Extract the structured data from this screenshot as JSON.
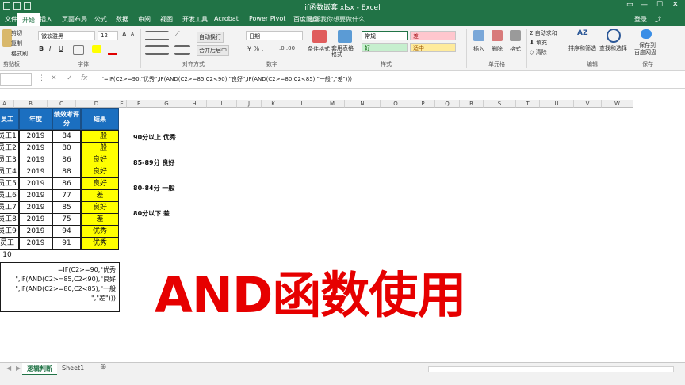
{
  "window": {
    "title": "if函数嵌套.xlsx - Excel"
  },
  "tabs": [
    "文件",
    "开始",
    "插入",
    "页面布局",
    "公式",
    "数据",
    "审阅",
    "视图",
    "开发工具",
    "Acrobat",
    "Power Pivot",
    "百度网盘"
  ],
  "active_tab": "开始",
  "tell_me": "告诉我你想要做什么...",
  "login": "登录",
  "ribbon": {
    "clipboard": {
      "cut": "剪切",
      "copy": "复制",
      "format_painter": "格式刷",
      "group": "剪贴板"
    },
    "font": {
      "name": "微软雅黑",
      "size": "12",
      "group": "字体",
      "grow": "A",
      "shrink": "A",
      "bold": "B",
      "italic": "I",
      "underline": "U"
    },
    "alignment": {
      "wrap": "自动换行",
      "merge": "合并后居中",
      "group": "对齐方式"
    },
    "number": {
      "format": "日期",
      "group": "数字"
    },
    "styles": {
      "conditional": "条件格式",
      "table": "套用表格格式",
      "normal": "常规",
      "bad": "差",
      "good": "好",
      "neutral": "适中",
      "group": "样式",
      "colors": {
        "bad_bg": "#ffc7ce",
        "bad_fg": "#9c0006",
        "good_bg": "#c6efce",
        "good_fg": "#006100",
        "neutral_bg": "#ffeb9c",
        "neutral_fg": "#9c5700"
      }
    },
    "cells": {
      "insert": "插入",
      "delete": "删除",
      "format": "格式",
      "group": "单元格"
    },
    "editing": {
      "autosum": "自动求和",
      "fill": "填充",
      "clear": "清除",
      "sort": "排序和筛选",
      "find": "查找和选择",
      "group": "编辑"
    },
    "baidu": {
      "save": "保存到",
      "save2": "百度网盘",
      "group": "保存"
    }
  },
  "formula_bar": {
    "formula": "'=IF(C2>=90,\"优秀\",IF(AND(C2>=85,C2<90),\"良好\",IF(AND(C2>=80,C2<85),\"一般\",\"差\")))",
    "cancel": "✕",
    "enter": "✓",
    "fx": "fx"
  },
  "columns": [
    "A",
    "B",
    "C",
    "D",
    "E",
    "F",
    "G",
    "H",
    "I",
    "J",
    "K",
    "L",
    "M",
    "N",
    "O",
    "P",
    "Q",
    "R",
    "S",
    "T",
    "U",
    "V",
    "W"
  ],
  "table": {
    "headers": [
      "员工",
      "年度",
      "绩效考评分",
      "结果"
    ],
    "rows": [
      [
        "员工1",
        "2019",
        "84",
        "一般"
      ],
      [
        "员工2",
        "2019",
        "80",
        "一般"
      ],
      [
        "员工3",
        "2019",
        "86",
        "良好"
      ],
      [
        "员工4",
        "2019",
        "88",
        "良好"
      ],
      [
        "员工5",
        "2019",
        "86",
        "良好"
      ],
      [
        "员工6",
        "2019",
        "77",
        "差"
      ],
      [
        "员工7",
        "2019",
        "85",
        "良好"
      ],
      [
        "员工8",
        "2019",
        "75",
        "差"
      ],
      [
        "员工9",
        "2019",
        "94",
        "优秀"
      ],
      [
        "员工10",
        "2019",
        "91",
        "优秀"
      ]
    ]
  },
  "rules": [
    "90分以上 优秀",
    "85-89分 良好",
    "80-84分 一般",
    "80分以下 差"
  ],
  "formula_cell": [
    "=IF(C2>=90,\"优秀",
    "\",IF(AND(C2>=85,C2<90),\"良好",
    "\",IF(AND(C2>=80,C2<85),\"一般",
    "\",\"差\")))"
  ],
  "overlay_title": "AND函数使用",
  "sheets": [
    "逻辑判断",
    "Sheet1"
  ],
  "active_sheet": "逻辑判断",
  "colors": {
    "accent": "#217346",
    "header_blue": "#1b6fc0",
    "result_yellow": "#ffff00",
    "overlay_red": "#e60000"
  }
}
